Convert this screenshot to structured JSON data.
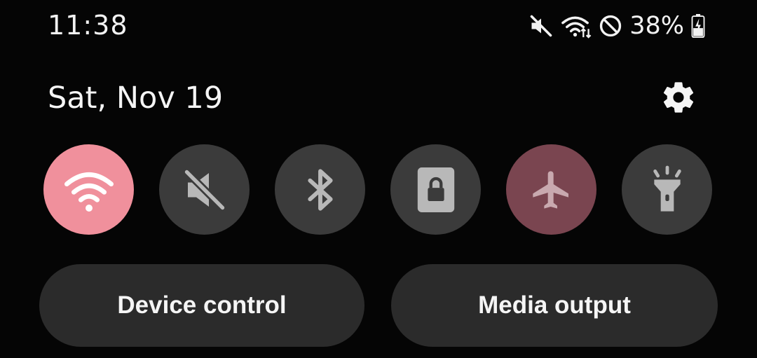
{
  "status_bar": {
    "time": "11:38",
    "battery_percent": "38%",
    "icons": [
      "mute-icon",
      "wifi-icon",
      "do-not-disturb-icon",
      "battery-charging-icon"
    ]
  },
  "header": {
    "date": "Sat, Nov 19",
    "settings_icon": "gear-icon"
  },
  "quick_tiles": [
    {
      "name": "Wi-Fi",
      "icon": "wifi-icon",
      "state": "on",
      "color": "#f0909c"
    },
    {
      "name": "Sound",
      "icon": "mute-icon",
      "state": "off"
    },
    {
      "name": "Bluetooth",
      "icon": "bluetooth-icon",
      "state": "off"
    },
    {
      "name": "Secure Folder",
      "icon": "secure-folder-icon",
      "state": "off"
    },
    {
      "name": "Airplane mode",
      "icon": "airplane-icon",
      "state": "on-dim",
      "color": "#7a4550"
    },
    {
      "name": "Flashlight",
      "icon": "flashlight-icon",
      "state": "off"
    }
  ],
  "buttons": {
    "device_control": "Device control",
    "media_output": "Media output"
  },
  "colors": {
    "background": "#050505",
    "tile_off": "#3b3b3b",
    "pill": "#2b2b2b"
  }
}
